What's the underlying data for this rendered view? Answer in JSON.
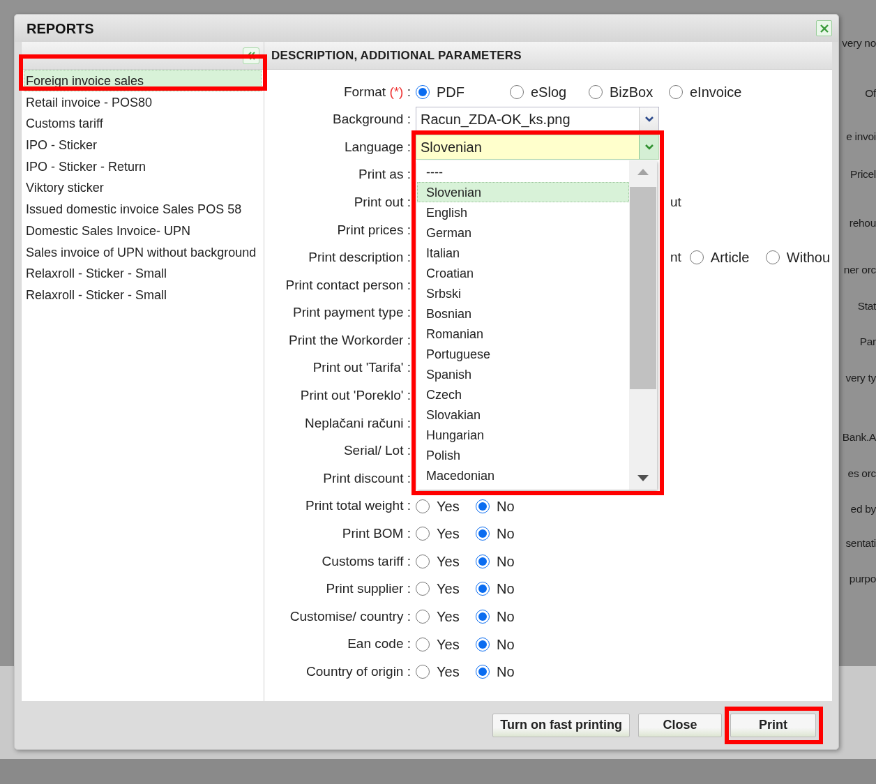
{
  "dialog": {
    "title": "REPORTS"
  },
  "reports": {
    "items": [
      {
        "label": "Foreign invoice sales",
        "selected": true,
        "highlighted": true
      },
      {
        "label": "Retail invoice - POS80",
        "selected": false,
        "highlighted": false
      },
      {
        "label": "Customs tariff",
        "selected": false,
        "highlighted": false
      },
      {
        "label": "IPO - Sticker",
        "selected": false,
        "highlighted": false
      },
      {
        "label": "IPO - Sticker - Return",
        "selected": false,
        "highlighted": false
      },
      {
        "label": "Viktory sticker",
        "selected": false,
        "highlighted": false
      },
      {
        "label": "Issued domestic invoice Sales POS 58",
        "selected": false,
        "highlighted": false
      },
      {
        "label": "Domestic Sales Invoice- UPN",
        "selected": false,
        "highlighted": false
      },
      {
        "label": "Sales invoice of UPN without background",
        "selected": false,
        "highlighted": false
      },
      {
        "label": "Relaxroll - Sticker - Small",
        "selected": false,
        "highlighted": false
      },
      {
        "label": "Relaxroll - Sticker - Small",
        "selected": false,
        "highlighted": false
      }
    ]
  },
  "parameters": {
    "title": "DESCRIPTION, ADDITIONAL PARAMETERS",
    "rows": [
      {
        "kind": "radio",
        "label": "Format",
        "required_mark": "(*)",
        "suffix": ":",
        "options": [
          {
            "label": "PDF",
            "selected": true
          },
          {
            "label": "eSlog",
            "selected": false
          },
          {
            "label": "BizBox",
            "selected": false
          },
          {
            "label": "eInvoice",
            "selected": false
          }
        ]
      },
      {
        "kind": "select",
        "label": "Background :",
        "value": "Racun_ZDA-OK_ks.png",
        "focused": false
      },
      {
        "kind": "select",
        "label": "Language :",
        "value": "Slovenian",
        "focused": true,
        "expanded": true,
        "highlighted": true,
        "options": [
          {
            "label": "----",
            "selected": false
          },
          {
            "label": "Slovenian",
            "selected": true
          },
          {
            "label": "English",
            "selected": false
          },
          {
            "label": "German",
            "selected": false
          },
          {
            "label": "Italian",
            "selected": false
          },
          {
            "label": "Croatian",
            "selected": false
          },
          {
            "label": "Srbski",
            "selected": false
          },
          {
            "label": "Bosnian",
            "selected": false
          },
          {
            "label": "Romanian",
            "selected": false
          },
          {
            "label": "Portuguese",
            "selected": false
          },
          {
            "label": "Spanish",
            "selected": false
          },
          {
            "label": "Czech",
            "selected": false
          },
          {
            "label": "Slovakian",
            "selected": false
          },
          {
            "label": "Hungarian",
            "selected": false
          },
          {
            "label": "Polish",
            "selected": false
          },
          {
            "label": "Macedonian",
            "selected": false
          }
        ]
      },
      {
        "kind": "covered",
        "label": "Print as :"
      },
      {
        "kind": "covered",
        "label": "Print out :",
        "visible_tail": "ut"
      },
      {
        "kind": "covered",
        "label": "Print prices :"
      },
      {
        "kind": "covered",
        "label": "Print description :",
        "visible_tail": "nt",
        "options": [
          {
            "label": "Article",
            "selected": false
          },
          {
            "label": "Withou",
            "selected": false
          }
        ]
      },
      {
        "kind": "covered",
        "label": "Print contact person :"
      },
      {
        "kind": "covered",
        "label": "Print payment type :"
      },
      {
        "kind": "covered",
        "label": "Print the Workorder :"
      },
      {
        "kind": "covered",
        "label": "Print out 'Tarifa' :"
      },
      {
        "kind": "covered",
        "label": "Print out 'Poreklo' :"
      },
      {
        "kind": "covered",
        "label": "Neplačani računi :"
      },
      {
        "kind": "covered",
        "label": "Serial/ Lot :"
      },
      {
        "kind": "covered",
        "label": "Print discount :"
      },
      {
        "kind": "radio",
        "label": "Print total weight :",
        "options": [
          {
            "label": "Yes",
            "selected": false
          },
          {
            "label": "No",
            "selected": true
          }
        ]
      },
      {
        "kind": "radio",
        "label": "Print BOM :",
        "options": [
          {
            "label": "Yes",
            "selected": false
          },
          {
            "label": "No",
            "selected": true
          }
        ]
      },
      {
        "kind": "radio",
        "label": "Customs tariff :",
        "options": [
          {
            "label": "Yes",
            "selected": false
          },
          {
            "label": "No",
            "selected": true
          }
        ]
      },
      {
        "kind": "radio",
        "label": "Print supplier :",
        "options": [
          {
            "label": "Yes",
            "selected": false
          },
          {
            "label": "No",
            "selected": true
          }
        ]
      },
      {
        "kind": "radio",
        "label": "Customise/ country :",
        "options": [
          {
            "label": "Yes",
            "selected": false
          },
          {
            "label": "No",
            "selected": true
          }
        ]
      },
      {
        "kind": "radio",
        "label": "Ean code :",
        "options": [
          {
            "label": "Yes",
            "selected": false
          },
          {
            "label": "No",
            "selected": true
          }
        ]
      },
      {
        "kind": "radio",
        "label": "Country of origin :",
        "options": [
          {
            "label": "Yes",
            "selected": false
          },
          {
            "label": "No",
            "selected": true
          }
        ]
      }
    ]
  },
  "buttons": [
    {
      "label": "Turn on fast printing"
    },
    {
      "label": "Close"
    },
    {
      "label": "Print",
      "highlighted": true
    }
  ],
  "background_texts": [
    "very no",
    "Of",
    "e invoi",
    "Pricel",
    "rehou",
    "ner orc",
    "Stat",
    "Par",
    "very ty",
    "Bank.A",
    "es orc",
    "ed by",
    "sentati",
    "purpo"
  ]
}
